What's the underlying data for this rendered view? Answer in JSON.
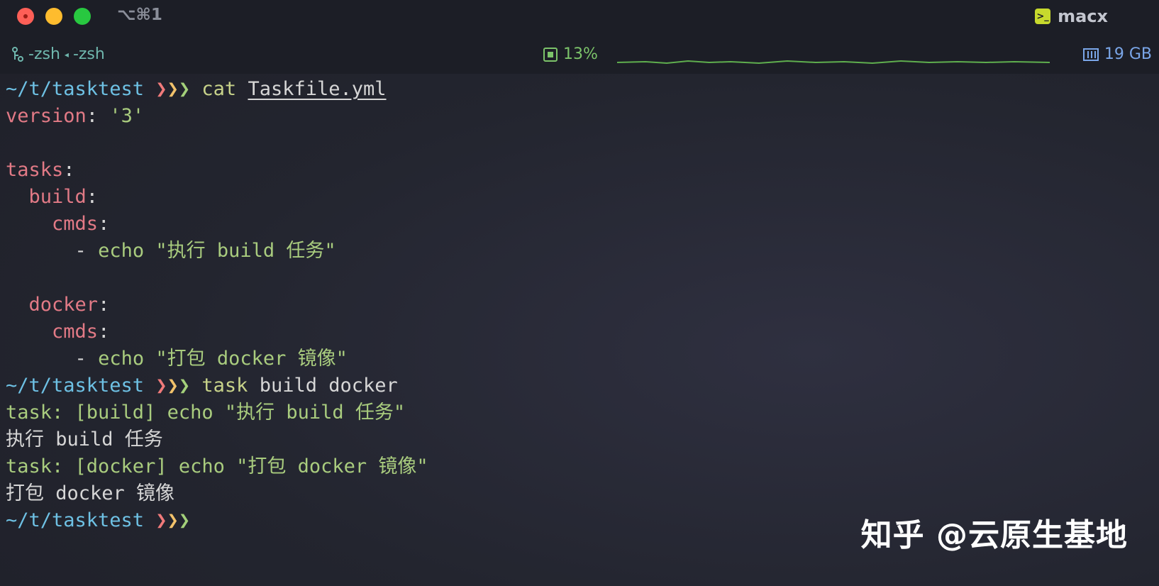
{
  "window": {
    "shortcut": "⌥⌘1",
    "session_name": "macx",
    "session_icon": "terminal-icon",
    "traffic_lights": {
      "close": "#fe5f57",
      "minimize": "#febc2e",
      "zoom": "#28c840"
    }
  },
  "status": {
    "tabs": [
      "-zsh",
      "-zsh"
    ],
    "cpu": "13%",
    "memory": "19 GB"
  },
  "prompt": {
    "path": "~/t/tasktest",
    "arrows": [
      "❯",
      "❯",
      "❯"
    ]
  },
  "lines": {
    "l1_cmd": "cat",
    "l1_arg": "Taskfile.yml",
    "l2_key": "version",
    "l2_colon": ": ",
    "l2_val": "'3'",
    "l4_key": "tasks",
    "l5_key": "build",
    "l6_key": "cmds",
    "l7_val": "echo \"执行 build 任务\"",
    "l9_key": "docker",
    "l10_key": "cmds",
    "l11_val": "echo \"打包 docker 镜像\"",
    "l12_cmd": "task",
    "l12_args": "build docker",
    "l13": "task: [build] echo \"执行 build 任务\"",
    "l14": "执行 build 任务",
    "l15": "task: [docker] echo \"打包 docker 镜像\"",
    "l16": "打包 docker 镜像"
  },
  "watermark": "知乎 @云原生基地"
}
